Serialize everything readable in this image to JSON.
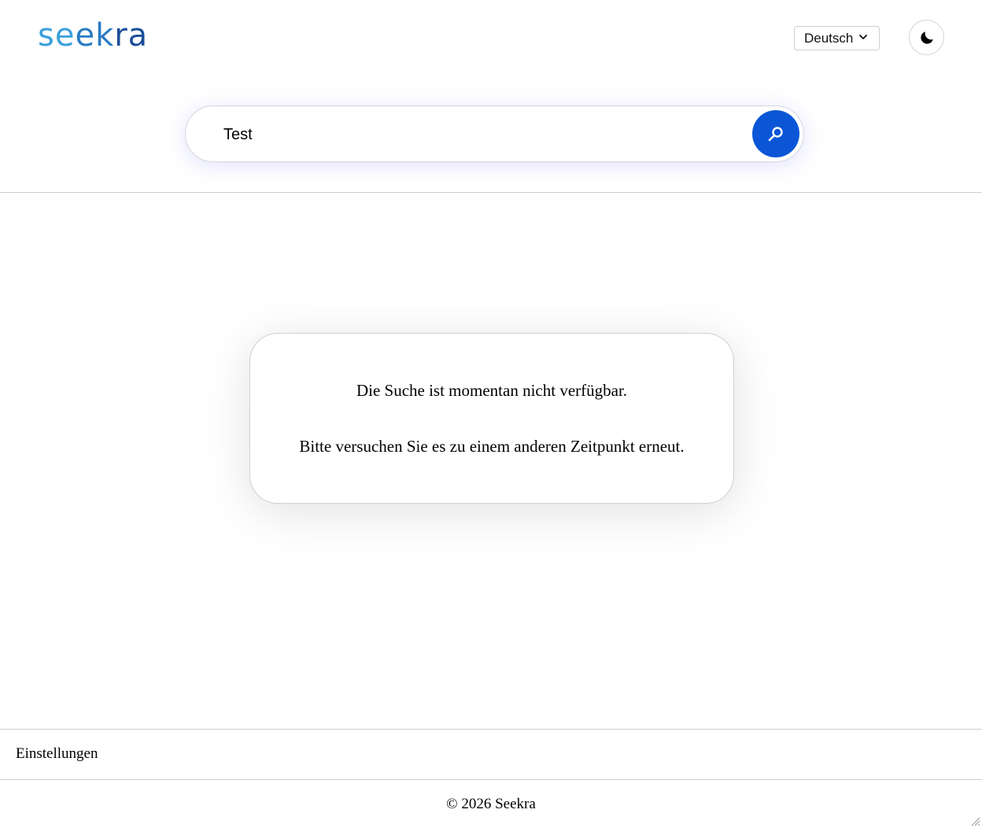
{
  "header": {
    "logo_parts": [
      "se",
      "ek",
      "ra"
    ],
    "language": {
      "selected": "Deutsch",
      "icon": "chevron-down-icon"
    },
    "theme_toggle": {
      "icon": "moon-icon"
    }
  },
  "search": {
    "value": "Test",
    "placeholder": "",
    "button_icon": "search-icon"
  },
  "message": {
    "line1": "Die Suche ist momentan nicht verfügbar.",
    "line2": "Bitte versuchen Sie es zu einem anderen Zeitpunkt erneut."
  },
  "footer": {
    "settings_label": "Einstellungen",
    "copyright": "© 2026 Seekra"
  },
  "colors": {
    "accent": "#0a56d6",
    "logo_light": "#3aa0dc",
    "logo_mid": "#2a7cc4",
    "logo_dark": "#1a4e99",
    "divider": "#cfcfcf"
  }
}
